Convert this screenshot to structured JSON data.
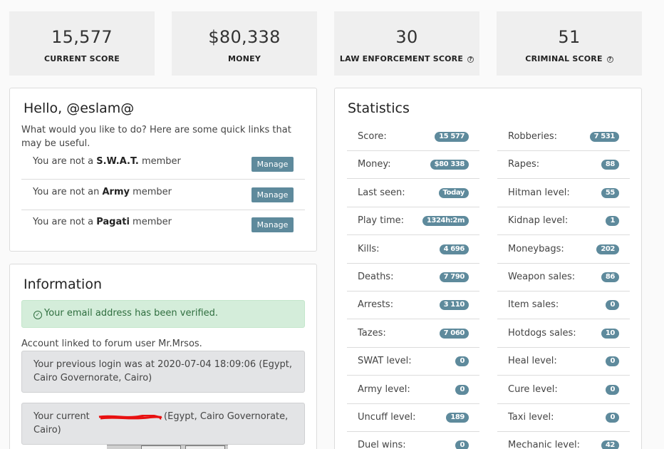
{
  "top_stats": [
    {
      "value": "15,577",
      "label": "CURRENT SCORE",
      "help": false
    },
    {
      "value": "$80,338",
      "label": "MONEY",
      "help": false
    },
    {
      "value": "30",
      "label": "LAW ENFORCEMENT SCORE",
      "help": true
    },
    {
      "value": "51",
      "label": "CRIMINAL SCORE",
      "help": true
    }
  ],
  "hello": {
    "title": "Hello, @eslam@",
    "intro": "What would you like to do? Here are some quick links that may be useful.",
    "memberships": [
      {
        "prefix": "You are not a ",
        "group": "S.W.A.T.",
        "suffix": " member",
        "button": "Manage"
      },
      {
        "prefix": "You are not an ",
        "group": "Army",
        "suffix": " member",
        "button": "Manage"
      },
      {
        "prefix": "You are not a ",
        "group": "Pagati",
        "suffix": " member",
        "button": "Manage"
      }
    ]
  },
  "info": {
    "title": "Information",
    "verified": "Your email address has been verified.",
    "linked": "Account linked to forum user Mr.Mrsos.",
    "previous_login": "Your previous login was at 2020-07-04 18:09:06 (Egypt, Cairo Governorate, Cairo)",
    "current_ip_prefix": "Your current ",
    "current_ip_suffix": " (Egypt, Cairo Governorate, Cairo)"
  },
  "stats": {
    "title": "Statistics",
    "left": [
      {
        "label": "Score:",
        "value": "15 577"
      },
      {
        "label": "Money:",
        "value": "$80 338"
      },
      {
        "label": "Last seen:",
        "value": "Today"
      },
      {
        "label": "Play time:",
        "value": "1324h:2m"
      },
      {
        "label": "Kills:",
        "value": "4 696"
      },
      {
        "label": "Deaths:",
        "value": "7 790"
      },
      {
        "label": "Arrests:",
        "value": "3 110"
      },
      {
        "label": "Tazes:",
        "value": "7 060"
      },
      {
        "label": "SWAT level:",
        "value": "0"
      },
      {
        "label": "Army level:",
        "value": "0"
      },
      {
        "label": "Uncuff level:",
        "value": "189"
      },
      {
        "label": "Duel wins:",
        "value": "0"
      }
    ],
    "right": [
      {
        "label": "Robberies:",
        "value": "7 531"
      },
      {
        "label": "Rapes:",
        "value": "88"
      },
      {
        "label": "Hitman level:",
        "value": "55"
      },
      {
        "label": "Kidnap level:",
        "value": "1"
      },
      {
        "label": "Moneybags:",
        "value": "202"
      },
      {
        "label": "Weapon sales:",
        "value": "86"
      },
      {
        "label": "Item sales:",
        "value": "0"
      },
      {
        "label": "Hotdogs sales:",
        "value": "10"
      },
      {
        "label": "Heal level:",
        "value": "0"
      },
      {
        "label": "Cure level:",
        "value": "0"
      },
      {
        "label": "Taxi level:",
        "value": "0"
      },
      {
        "label": "Mechanic level:",
        "value": "42"
      }
    ]
  },
  "colors": {
    "badge": "#5e8a9c",
    "alert_bg": "#d4edda",
    "alert_text": "#2f6e3f"
  }
}
